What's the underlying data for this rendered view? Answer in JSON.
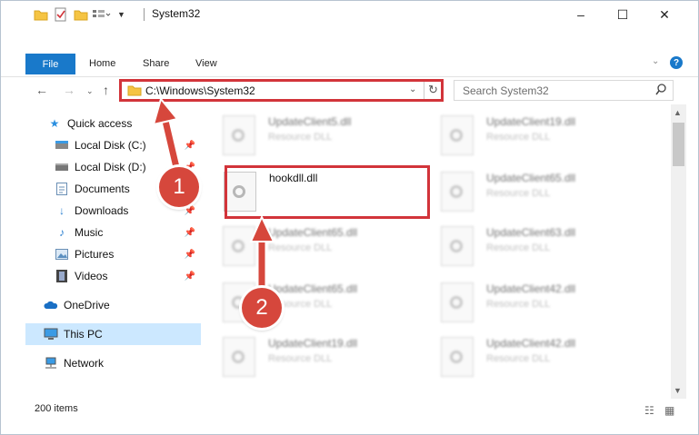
{
  "window": {
    "title": "System32",
    "controls": [
      "–",
      "☐",
      "✕"
    ]
  },
  "ribbon": {
    "tabs": [
      "File",
      "Home",
      "Share",
      "View"
    ]
  },
  "address": {
    "path": "C:\\Windows\\System32"
  },
  "search": {
    "placeholder": "Search System32"
  },
  "sidebar": {
    "items": [
      {
        "label": "Quick access",
        "icon": "star-icon"
      },
      {
        "label": "Local Disk (C:)",
        "icon": "drive-icon",
        "pinned": true
      },
      {
        "label": "Local Disk (D:)",
        "icon": "drive-icon",
        "pinned": true
      },
      {
        "label": "Documents",
        "icon": "documents-icon",
        "pinned": true
      },
      {
        "label": "Downloads",
        "icon": "downloads-icon",
        "pinned": true
      },
      {
        "label": "Music",
        "icon": "music-icon",
        "pinned": true
      },
      {
        "label": "Pictures",
        "icon": "pictures-icon",
        "pinned": true
      },
      {
        "label": "Videos",
        "icon": "videos-icon",
        "pinned": true
      },
      {
        "label": "OneDrive",
        "icon": "cloud-icon"
      },
      {
        "label": "This PC",
        "icon": "computer-icon",
        "selected": true
      },
      {
        "label": "Network",
        "icon": "network-icon"
      }
    ]
  },
  "files": [
    {
      "name": "UpdateClient5.dll",
      "type": "Resource DLL"
    },
    {
      "name": "UpdateClient19.dll",
      "type": "Resource DLL"
    },
    {
      "name": "hookdll.dll",
      "type": ""
    },
    {
      "name": "UpdateClient65.dll",
      "type": "Resource DLL"
    },
    {
      "name": "UpdateClient65.dll",
      "type": "Resource DLL"
    },
    {
      "name": "UpdateClient63.dll",
      "type": "Resource DLL"
    },
    {
      "name": "UpdateClient65.dll",
      "type": "Resource DLL"
    },
    {
      "name": "UpdateClient42.dll",
      "type": "Resource DLL"
    },
    {
      "name": "UpdateClient19.dll",
      "type": "Resource DLL"
    },
    {
      "name": "UpdateClient42.dll",
      "type": "Resource DLL"
    }
  ],
  "status": {
    "item_count": "200 items"
  },
  "annotations": {
    "step1": "1",
    "step2": "2",
    "color": "#d2343a"
  }
}
